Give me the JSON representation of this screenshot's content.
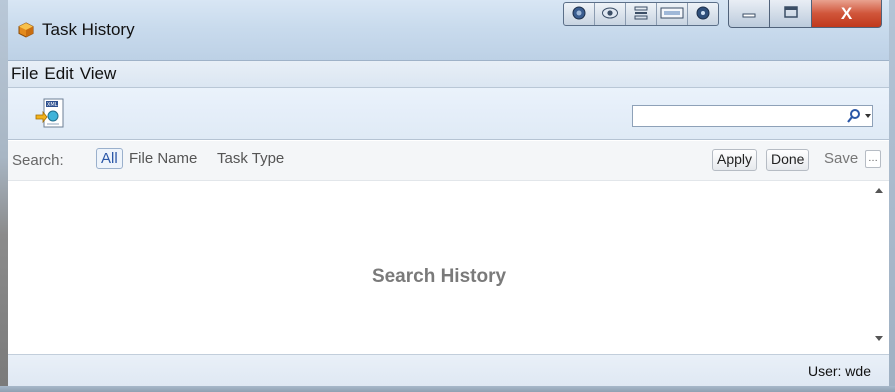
{
  "window": {
    "title": "Task History",
    "title_icon": "task-history-app-icon",
    "tools": [
      "palette-icon",
      "eye-icon",
      "stack-icon",
      "panel-icon",
      "record-icon"
    ],
    "controls": {
      "minimize": "minimize-icon",
      "maximize": "maximize-icon",
      "close": "X"
    }
  },
  "menubar": {
    "items": [
      "File",
      "Edit",
      "View"
    ]
  },
  "toolbar": {
    "export_icon": "xml-export-icon",
    "search": {
      "value": "",
      "placeholder": "",
      "icon": "search-icon"
    }
  },
  "filterbar": {
    "label": "Search:",
    "chips": [
      "All",
      "File Name",
      "Task Type"
    ],
    "apply_label": "Apply",
    "done_label": "Done",
    "save_label": "Save",
    "more_label": "…"
  },
  "content": {
    "empty_text": "Search History"
  },
  "status": {
    "user": "User: wde"
  },
  "colors": {
    "titlebar": "#c9dbed",
    "close_button": "#c0391c",
    "chip_all_text": "#2b57a7",
    "empty_text": "#7a7a7a"
  }
}
